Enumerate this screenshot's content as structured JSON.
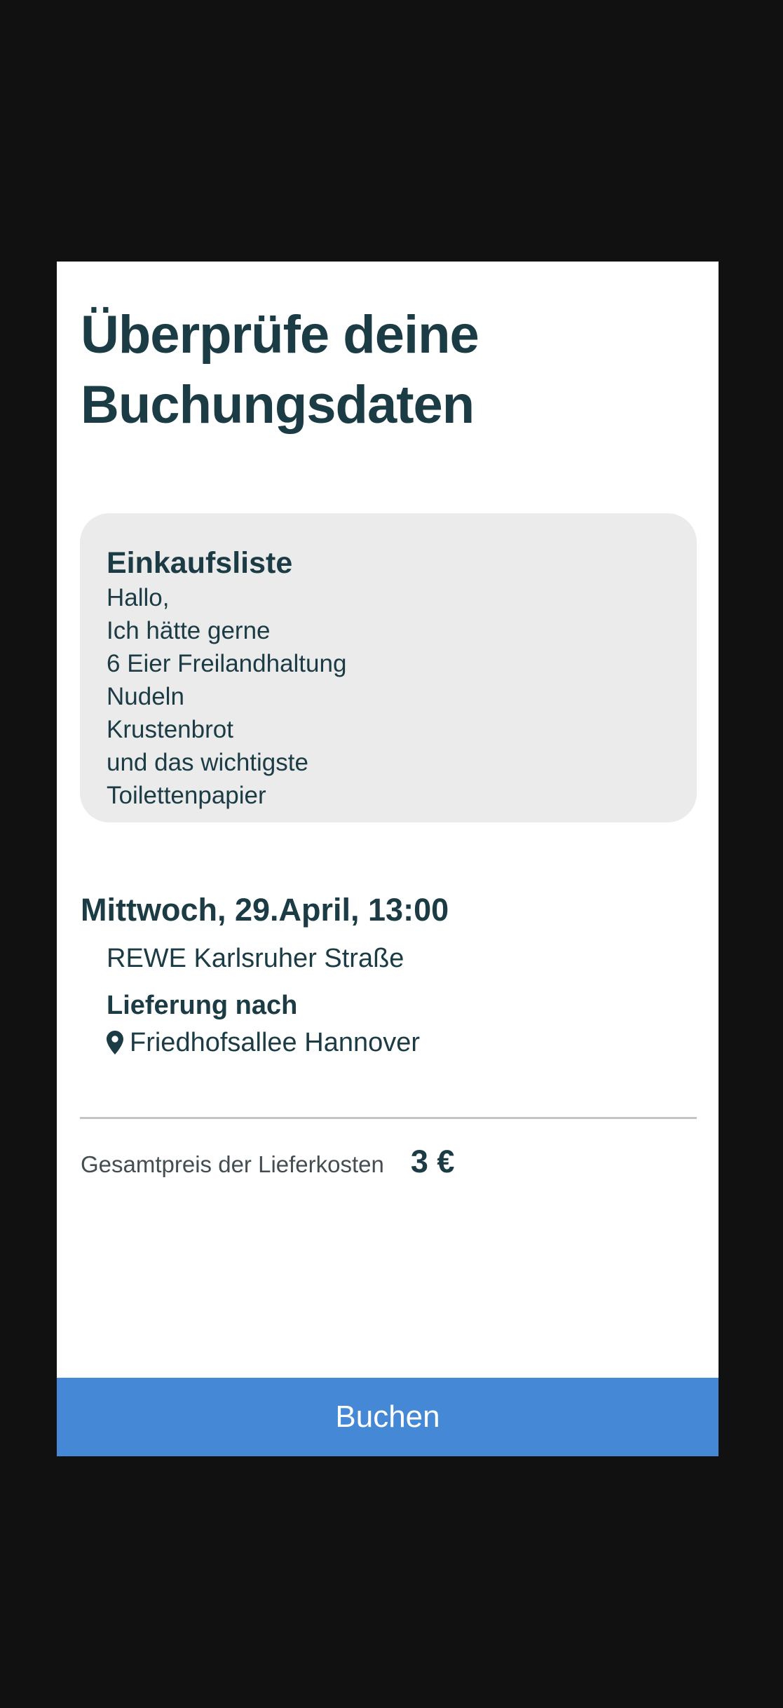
{
  "review": {
    "title_line1": "Überprüfe deine",
    "title_line2": "Buchungsdaten"
  },
  "shopping_list": {
    "heading": "Einkaufsliste",
    "lines": [
      "Hallo,",
      "Ich hätte gerne",
      "6 Eier Freilandhaltung",
      "Nudeln",
      "Krustenbrot",
      "und das wichtigste",
      "Toilettenpapier"
    ]
  },
  "appointment": {
    "datetime": "Mittwoch, 29.April, 13:00",
    "store": "REWE Karlsruher Straße",
    "delivery_label": "Lieferung nach",
    "delivery_address": "Friedhofsallee Hannover",
    "address_icon": "map-pin-icon"
  },
  "pricing": {
    "label": "Gesamtpreis der Lieferkosten",
    "value": "3 €"
  },
  "actions": {
    "book_label": "Buchen"
  },
  "colors": {
    "background": "#111111",
    "card": "#ffffff",
    "text": "#1b3b45",
    "list_box": "#ebebeb",
    "button": "#4589d6"
  }
}
